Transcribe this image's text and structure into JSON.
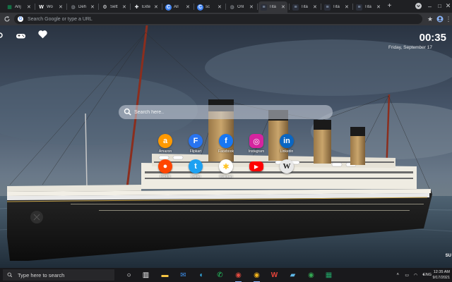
{
  "browser": {
    "tabs": [
      {
        "title": "Anj",
        "icon": "sheets-icon",
        "color": "#0f9d58"
      },
      {
        "title": "Wo",
        "icon": "wikipedia-icon",
        "color": "#ffffff"
      },
      {
        "title": "Deh",
        "icon": "globe-icon",
        "color": "#9aa0a6"
      },
      {
        "title": "Sett",
        "icon": "gear-icon",
        "color": "#e8eaed"
      },
      {
        "title": "Exte",
        "icon": "puzzle-icon",
        "color": "#e8eaed"
      },
      {
        "title": "All",
        "icon": "c-icon",
        "color": "#4285f4"
      },
      {
        "title": "sc",
        "icon": "c-icon",
        "color": "#4285f4"
      },
      {
        "title": "Onl",
        "icon": "globe-icon",
        "color": "#9aa0a6"
      },
      {
        "title": "Tita",
        "icon": "titanic-tab-icon",
        "color": "#2b2f3a",
        "active": true
      },
      {
        "title": "Tita",
        "icon": "titanic-tab-icon",
        "color": "#2b2f3a"
      },
      {
        "title": "Tita",
        "icon": "titanic-tab-icon",
        "color": "#2b2f3a"
      },
      {
        "title": "Tita",
        "icon": "titanic-tab-icon",
        "color": "#2b2f3a"
      }
    ],
    "new_tab_symbol": "+",
    "omnibox_placeholder": "Search Google or type a URL"
  },
  "page": {
    "clock": "00:35",
    "date": "Friday, September 17",
    "search_placeholder": "Search here..",
    "shortcuts_row1": [
      {
        "label": "Amazon",
        "icon": "amazon-icon",
        "glyph": "a",
        "color": "#ff9900"
      },
      {
        "label": "Flipkart",
        "icon": "flipkart-icon",
        "glyph": "F",
        "color": "#2874f0"
      },
      {
        "label": "Facebook",
        "icon": "facebook-icon",
        "glyph": "f",
        "color": "#1877f2"
      },
      {
        "label": "Instagram",
        "icon": "instagram-icon",
        "glyph": "◎",
        "color": "#d6249f"
      },
      {
        "label": "Linkedin",
        "icon": "linkedin-icon",
        "glyph": "in",
        "color": "#0a66c2"
      }
    ],
    "shortcuts_row2": [
      {
        "label": "Reddit",
        "icon": "reddit-icon",
        "glyph": "●",
        "color": "#ff4500"
      },
      {
        "label": "Twitter",
        "icon": "twitter-icon",
        "glyph": "t",
        "color": "#1da1f2"
      },
      {
        "label": "Walmart",
        "icon": "walmart-icon",
        "glyph": "✱",
        "color": "#ffc220"
      },
      {
        "label": "",
        "icon": "youtube-icon",
        "glyph": "▶",
        "color": "#ff0000"
      },
      {
        "label": "",
        "icon": "wikipedia-icon",
        "glyph": "W",
        "color": "#e8e8e8"
      }
    ],
    "corner_label": "SU"
  },
  "taskbar": {
    "search_placeholder": "Type here to search",
    "apps": [
      "search-circle-icon",
      "task-view-icon",
      "file-explorer-icon",
      "mail-icon",
      "edge-icon",
      "whatsapp-icon",
      "chrome-red-icon",
      "chrome-icon",
      "wps-icon",
      "notes-icon",
      "chrome-alt-icon",
      "excel-icon"
    ],
    "language": "ENG",
    "time": "12:35 AM",
    "date": "9/17/2021"
  }
}
